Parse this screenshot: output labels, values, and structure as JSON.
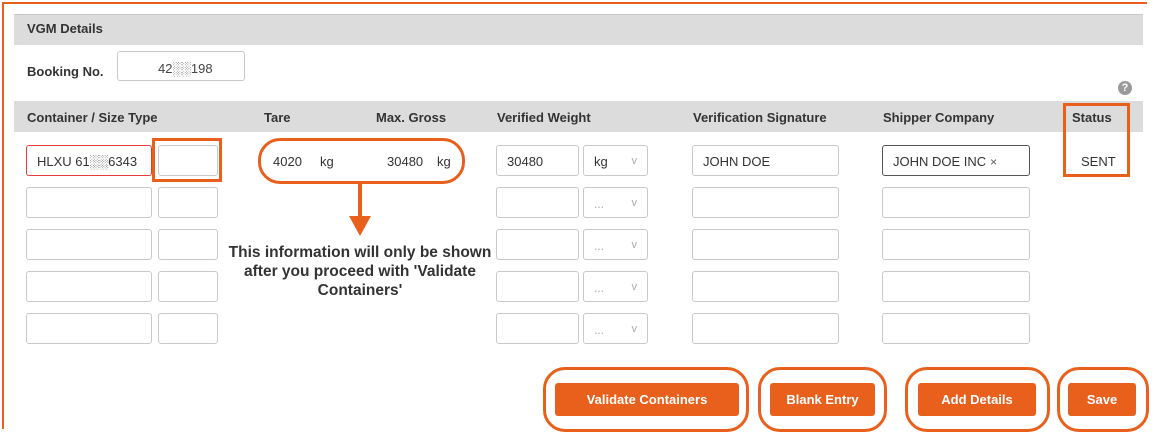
{
  "section": {
    "title": "VGM Details"
  },
  "booking": {
    "label": "Booking No.",
    "value": "42░░198"
  },
  "help": {
    "glyph": "?"
  },
  "columns": {
    "container": "Container / Size Type",
    "tare": "Tare",
    "max_gross": "Max. Gross",
    "verified_weight": "Verified Weight",
    "verification_signature": "Verification Signature",
    "shipper_company": "Shipper Company",
    "status": "Status"
  },
  "rows": [
    {
      "container": "HLXU 61░░6343",
      "size_type": "",
      "tare_value": "4020",
      "tare_unit": "kg",
      "max_gross_value": "30480",
      "max_gross_unit": "kg",
      "verified_weight": "30480",
      "weight_unit": "kg",
      "signature": "JOHN DOE",
      "shipper_company": "JOHN DOE INC",
      "shipper_remove": "×",
      "status": "SENT"
    }
  ],
  "empty_unit_placeholder": "...",
  "chevron": "v",
  "note": "This information will only be shown after you proceed with 'Validate Containers'",
  "buttons": {
    "validate": "Validate Containers",
    "blank": "Blank Entry",
    "add": "Add Details",
    "save": "Save"
  },
  "accent_color": "#e8601c"
}
